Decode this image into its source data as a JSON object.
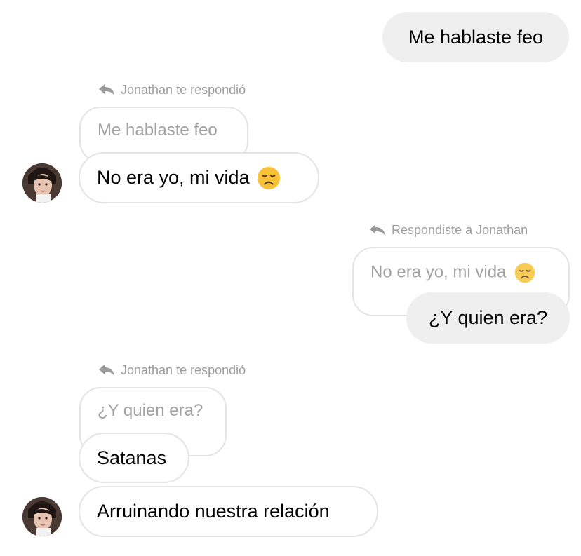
{
  "thread": {
    "msg1": {
      "text": "Me hablaste feo"
    },
    "reply1": {
      "label": "Jonathan te respondió",
      "quote": "Me hablaste feo",
      "text": "No era yo, mi vida",
      "emoji": "disappointed-face-emoji"
    },
    "reply2": {
      "label": "Respondiste a Jonathan",
      "quote": "No era yo, mi vida",
      "quote_emoji": "disappointed-face-emoji",
      "text": "¿Y quien era?"
    },
    "reply3": {
      "label": "Jonathan te respondió",
      "quote": "¿Y quien era?",
      "text": "Satanas"
    },
    "msg5": {
      "text": "Arruinando nuestra relación"
    }
  },
  "icons": {
    "reply": "reply-arrow-icon",
    "avatar": "contact-avatar"
  },
  "colors": {
    "outgoing_bubble": "#efefef",
    "incoming_border": "#e4e4e4",
    "meta_text": "#9c9c9c",
    "emoji_face": "#f7c23a"
  }
}
